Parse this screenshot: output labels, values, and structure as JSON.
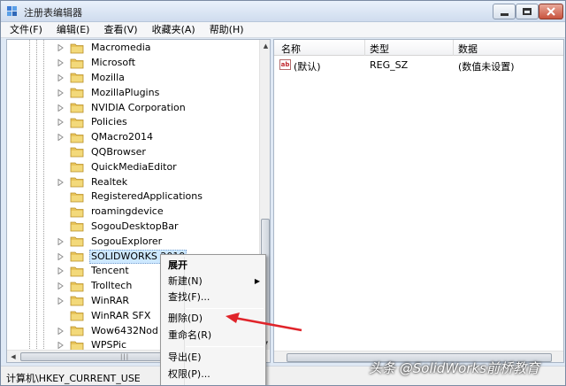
{
  "window": {
    "title": "注册表编辑器"
  },
  "menu": [
    "文件(F)",
    "编辑(E)",
    "查看(V)",
    "收藏夹(A)",
    "帮助(H)"
  ],
  "tree": [
    {
      "label": "Macromedia",
      "expandable": true
    },
    {
      "label": "Microsoft",
      "expandable": true
    },
    {
      "label": "Mozilla",
      "expandable": true
    },
    {
      "label": "MozillaPlugins",
      "expandable": true
    },
    {
      "label": "NVIDIA Corporation",
      "expandable": true
    },
    {
      "label": "Policies",
      "expandable": true
    },
    {
      "label": "QMacro2014",
      "expandable": true
    },
    {
      "label": "QQBrowser",
      "expandable": false
    },
    {
      "label": "QuickMediaEditor",
      "expandable": false
    },
    {
      "label": "Realtek",
      "expandable": true
    },
    {
      "label": "RegisteredApplications",
      "expandable": false
    },
    {
      "label": "roamingdevice",
      "expandable": false
    },
    {
      "label": "SogouDesktopBar",
      "expandable": false
    },
    {
      "label": "SogouExplorer",
      "expandable": true
    },
    {
      "label": "SOLIDWORKS 2019",
      "expandable": true,
      "selected": true
    },
    {
      "label": "Tencent",
      "expandable": true
    },
    {
      "label": "Trolltech",
      "expandable": true
    },
    {
      "label": "WinRAR",
      "expandable": true
    },
    {
      "label": "WinRAR SFX",
      "expandable": false
    },
    {
      "label": "Wow6432Nod",
      "expandable": true
    },
    {
      "label": "WPSPic",
      "expandable": true
    }
  ],
  "values_pane": {
    "columns": {
      "name": "名称",
      "type": "类型",
      "data": "数据"
    },
    "rows": [
      {
        "name": "(默认)",
        "type": "REG_SZ",
        "data": "(数值未设置)"
      }
    ]
  },
  "context_menu": {
    "expand": "展开",
    "new": "新建(N)",
    "find": "查找(F)...",
    "delete": "删除(D)",
    "rename": "重命名(R)",
    "export": "导出(E)",
    "permissions": "权限(P)..."
  },
  "status": {
    "path": "计算机\\HKEY_CURRENT_USER\\S"
  },
  "watermark": "头条 @SolidWorks前桥教育",
  "colors": {
    "folder": "#e8c45a",
    "selection": "#cde8ff",
    "arrow": "#e0242a"
  }
}
